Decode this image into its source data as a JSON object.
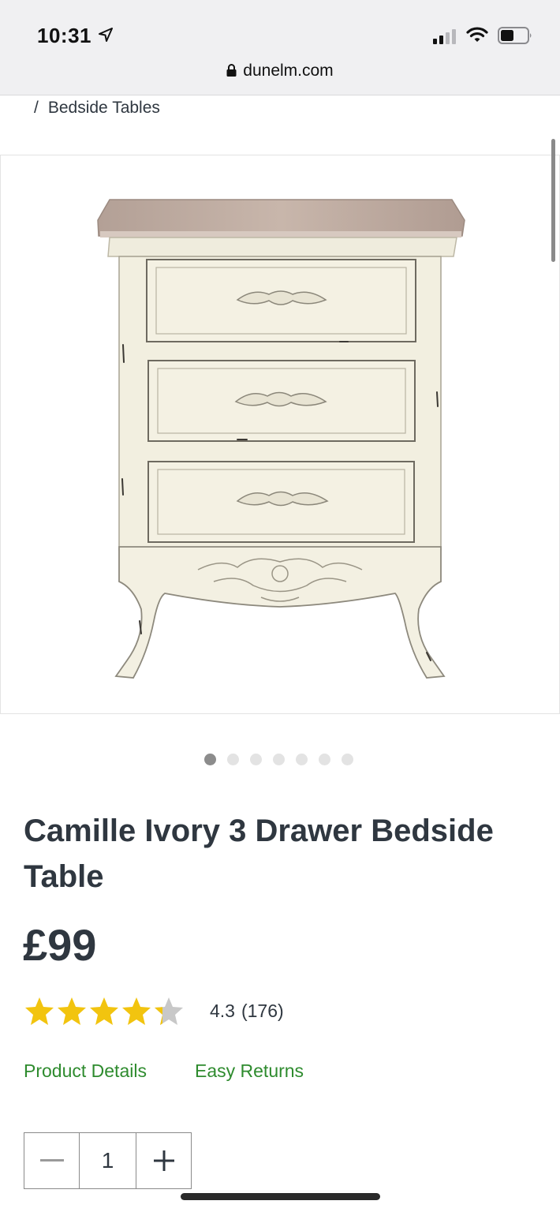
{
  "status_bar": {
    "time": "10:31",
    "icons": [
      "location-arrow-icon",
      "signal-icon",
      "wifi-icon",
      "battery-icon"
    ]
  },
  "browser": {
    "url": "dunelm.com",
    "icon": "lock-icon"
  },
  "breadcrumb": {
    "separator": "/",
    "current": "Bedside Tables"
  },
  "carousel": {
    "image_alt_icon": "bedside-table-image",
    "dot_count": 7,
    "active_index": 0
  },
  "product": {
    "title": "Camille Ivory 3 Drawer Bedside Table",
    "price": "£99",
    "rating": {
      "value": "4.3",
      "count": "(176)",
      "stars_filled": 4.3,
      "stars_max": 5
    },
    "links": {
      "details": "Product Details",
      "returns": "Easy Returns"
    }
  },
  "quantity": {
    "value": "1",
    "decrement_icon": "minus-icon",
    "increment_icon": "plus-icon"
  },
  "colors": {
    "accent_green": "#2e8b2e",
    "star_gold": "#f2c40f",
    "star_grey": "#c8c8c8",
    "text_dark": "#2f3740"
  }
}
